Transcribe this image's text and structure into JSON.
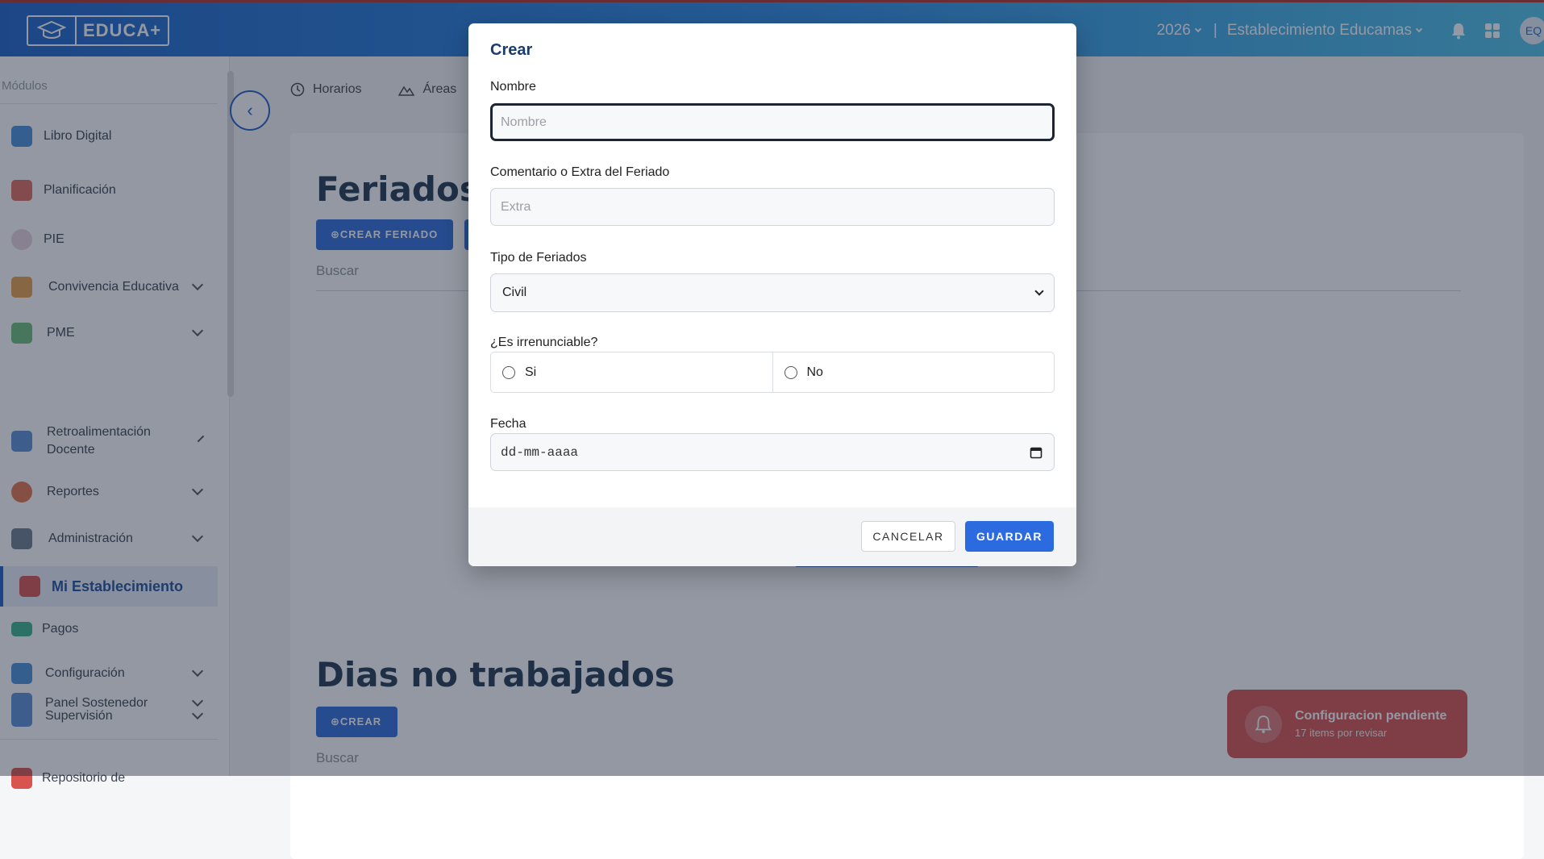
{
  "header": {
    "logo_text": "EDUCA+",
    "year": "2026",
    "separator": "|",
    "establishment": "Establecimiento Educamas",
    "avatar_initials": "EQ"
  },
  "sidebar": {
    "title": "Módulos",
    "items": [
      {
        "label": "Libro Digital",
        "icon": "book-icon",
        "color": "#4a90d9"
      },
      {
        "label": "Planificación",
        "icon": "calendar-icon",
        "color": "#e06b5c"
      },
      {
        "label": "PIE",
        "icon": "pie-icon",
        "color": "#d9b8c9"
      },
      {
        "label": "Convivencia Educativa",
        "icon": "people-icon",
        "color": "#e8a04a"
      },
      {
        "label": "PME",
        "icon": "shapes-icon",
        "color": "#6bbf7a"
      },
      {
        "label": "Retroalimentación Docente",
        "icon": "feedback-icon",
        "color": "#5b8fd6"
      },
      {
        "label": "Reportes",
        "icon": "chart-pie-icon",
        "color": "#e6734c"
      },
      {
        "label": "Administración",
        "icon": "wrench-icon",
        "color": "#6d7c8c"
      },
      {
        "label": "Mi Establecimiento",
        "icon": "school-icon",
        "color": "#d9534f"
      },
      {
        "label": "Pagos",
        "icon": "money-icon",
        "color": "#3db38a"
      },
      {
        "label": "Configuración",
        "icon": "tools-icon",
        "color": "#4a90d9"
      },
      {
        "label": "Supervisión",
        "icon": "supervision-icon",
        "color": "#5b8fd6"
      },
      {
        "label": "Panel Sostenedor",
        "icon": "panel-icon",
        "color": "#5b8fd6"
      },
      {
        "label": "Repositorio de",
        "icon": "repo-icon",
        "color": "#d9534f"
      }
    ]
  },
  "main": {
    "tabs": [
      {
        "label": "Horarios",
        "icon": "clock-icon"
      },
      {
        "label": "Áreas",
        "icon": "mountain-icon"
      }
    ],
    "feriados_title": "Feriados",
    "crear_feriado_label": "⊕CREAR FERIADO",
    "search_label": "Buscar",
    "dias_title": "Dias no trabajados",
    "crear_label": "⊕CREAR",
    "search_label_2": "Buscar"
  },
  "toast": {
    "title": "Configuracion pendiente",
    "subtitle": "17 items por revisar"
  },
  "modal": {
    "title": "Crear",
    "nombre_label": "Nombre",
    "nombre_placeholder": "Nombre",
    "extra_label": "Comentario o Extra del Feriado",
    "extra_placeholder": "Extra",
    "tipo_label": "Tipo de Feriados",
    "tipo_value": "Civil",
    "irrenunciable_label": "¿Es irrenunciable?",
    "opt_si": "Si",
    "opt_no": "No",
    "fecha_label": "Fecha",
    "fecha_value": "dd-mm-aaaa",
    "cancel_label": "CANCELAR",
    "save_label": "GUARDAR"
  },
  "colors": {
    "primary": "#2c6ae0",
    "title": "#1b3d6e",
    "toast": "#d9524f"
  }
}
